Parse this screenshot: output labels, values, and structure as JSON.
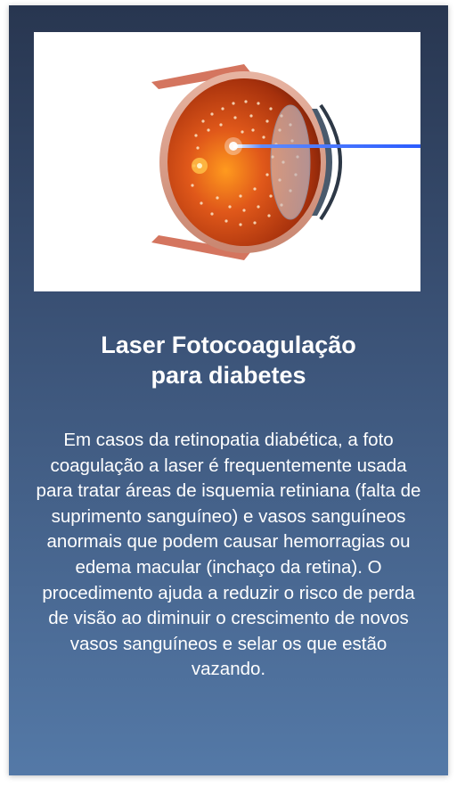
{
  "card": {
    "image": {
      "icon": "eye-laser-photocoagulation-illustration"
    },
    "title": {
      "line1": "Laser Fotocoagulação",
      "line2": "para diabetes"
    },
    "body": "Em casos da retinopatia diabética, a foto coagulação a laser é frequentemente usada para tratar áreas de isquemia retiniana (falta de suprimento sanguíneo) e vasos sanguíneos anormais que podem causar hemorragias ou edema macular (inchaço da retina). O procedimento ajuda a reduzir o risco de perda de visão ao diminuir o crescimento de novos vasos sanguíneos e selar os que estão vazando."
  },
  "colors": {
    "card_top": "#283650",
    "card_bottom": "#5479a7",
    "laser": "#2b5cff",
    "retina": "#c8410f",
    "text": "#ffffff"
  }
}
